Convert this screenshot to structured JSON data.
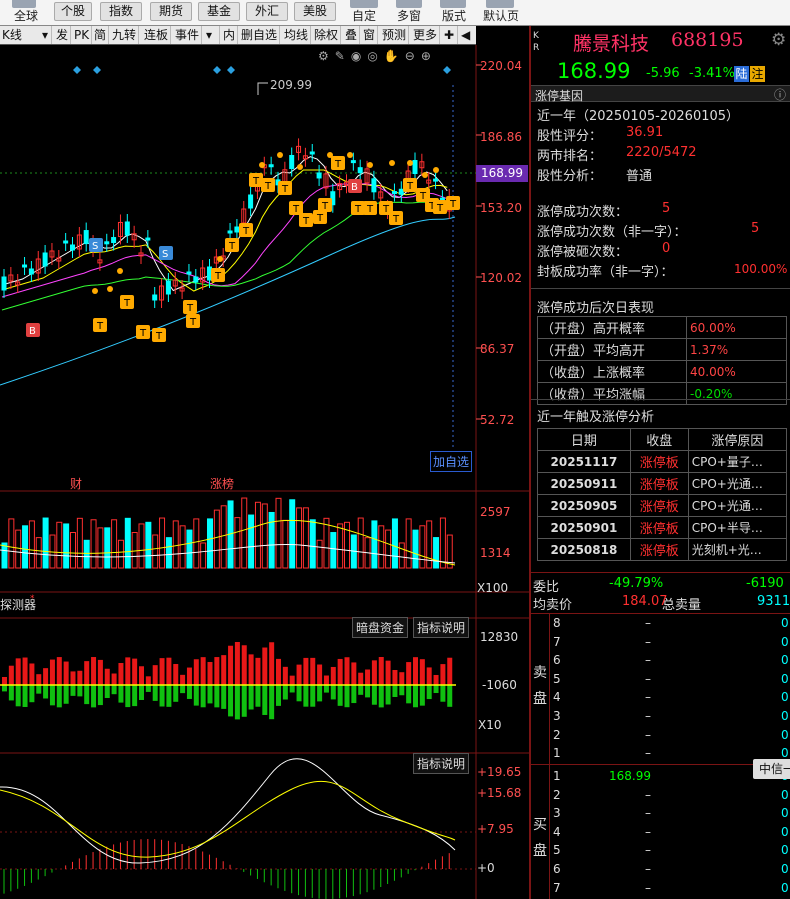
{
  "toolbar": {
    "global": "全球",
    "tabs": [
      "个股",
      "指数",
      "期货",
      "基金",
      "外汇",
      "美股"
    ],
    "right": [
      "自定",
      "多窗",
      "版式",
      "默认页"
    ]
  },
  "kline_toolbar": {
    "period": "K线",
    "items": [
      "发",
      "PK",
      "简",
      "九转",
      "连板",
      "事件",
      "内",
      "删自选",
      "均线",
      "除权",
      "叠",
      "窗",
      "预测",
      "更多"
    ]
  },
  "price_axis": [
    "220.04",
    "186.86",
    "153.20",
    "120.02",
    "86.37",
    "52.72"
  ],
  "current_price_tag": "168.99",
  "high_label": "209.99",
  "add_watchlist": "加自选",
  "event_labels": [
    "财",
    "涨榜"
  ],
  "volume_axis": [
    "2597",
    "1314",
    "X100"
  ],
  "fund_panel": {
    "name": "探测器",
    "buttons": [
      "暗盘资金",
      "指标说明"
    ],
    "axis": [
      "12830",
      "-1060",
      "X10"
    ]
  },
  "macd_panel": {
    "button": "指标说明",
    "axis": [
      "+19.65",
      "+15.68",
      "+7.95",
      "+0"
    ]
  },
  "stock": {
    "corner": "K\nR",
    "name": "騰景科技",
    "code": "688195",
    "price": "168.99",
    "change": "-5.96",
    "change_pct": "-3.41%",
    "badge1": "陆",
    "badge2": "注"
  },
  "gene": {
    "title": "涨停基因",
    "period": "近一年（20250105-20260105）",
    "score_label": "股性评分：",
    "score": "36.91",
    "rank_label": "两市排名：",
    "rank": "2220/5472",
    "analysis_label": "股性分析：",
    "analysis": "普通",
    "stats": [
      {
        "label": "涨停成功次数：",
        "value": "5"
      },
      {
        "label": "涨停成功次数（非一字）：",
        "value": "5"
      },
      {
        "label": "涨停被砸次数：",
        "value": "0"
      },
      {
        "label": "封板成功率（非一字）：",
        "value": "100.00%"
      }
    ],
    "next_day_title": "涨停成功后次日表现",
    "next_day": [
      {
        "label": "（开盘）高开概率",
        "value": "60.00%",
        "color": "#ff4444"
      },
      {
        "label": "（开盘）平均高开",
        "value": "1.37%",
        "color": "#ff4444"
      },
      {
        "label": "（收盘）上涨概率",
        "value": "40.00%",
        "color": "#ff4444"
      },
      {
        "label": "（收盘）平均涨幅",
        "value": "-0.20%",
        "color": "#00dd00"
      }
    ],
    "analysis_title": "近一年触及涨停分析",
    "table_headers": [
      "日期",
      "收盘",
      "涨停原因"
    ],
    "table_rows": [
      {
        "date": "20251117",
        "close": "涨停板",
        "reason": "CPO+量子…"
      },
      {
        "date": "20250911",
        "close": "涨停板",
        "reason": "CPO+光通…"
      },
      {
        "date": "20250905",
        "close": "涨停板",
        "reason": "CPO+光通…"
      },
      {
        "date": "20250901",
        "close": "涨停板",
        "reason": "CPO+半导…"
      },
      {
        "date": "20250818",
        "close": "涨停板",
        "reason": "光刻机+光…"
      }
    ]
  },
  "orderbook": {
    "ratio_label": "委比",
    "ratio": "-49.79%",
    "ratio_diff": "-6190",
    "avg_label": "均卖价",
    "avg": "184.07",
    "total_label": "总卖量",
    "total": "9311",
    "sell_label": "卖盘",
    "buy_label": "买盘",
    "sell": [
      {
        "lv": "8",
        "p": "–",
        "v": "0"
      },
      {
        "lv": "7",
        "p": "–",
        "v": "0"
      },
      {
        "lv": "6",
        "p": "–",
        "v": "0"
      },
      {
        "lv": "5",
        "p": "–",
        "v": "0"
      },
      {
        "lv": "4",
        "p": "–",
        "v": "0"
      },
      {
        "lv": "3",
        "p": "–",
        "v": "0"
      },
      {
        "lv": "2",
        "p": "–",
        "v": "0"
      },
      {
        "lv": "1",
        "p": "–",
        "v": "0"
      }
    ],
    "buy": [
      {
        "lv": "1",
        "p": "168.99",
        "v": "0"
      },
      {
        "lv": "2",
        "p": "–",
        "v": "0"
      },
      {
        "lv": "3",
        "p": "–",
        "v": "0"
      },
      {
        "lv": "4",
        "p": "–",
        "v": "0"
      },
      {
        "lv": "5",
        "p": "–",
        "v": "0"
      },
      {
        "lv": "6",
        "p": "–",
        "v": "0"
      },
      {
        "lv": "7",
        "p": "–",
        "v": "0"
      }
    ],
    "broker": "中信一"
  },
  "colors": {
    "up": "#ff3030",
    "down": "#00ffff",
    "accent": "#ff3366",
    "limit": "#ffaa00"
  }
}
